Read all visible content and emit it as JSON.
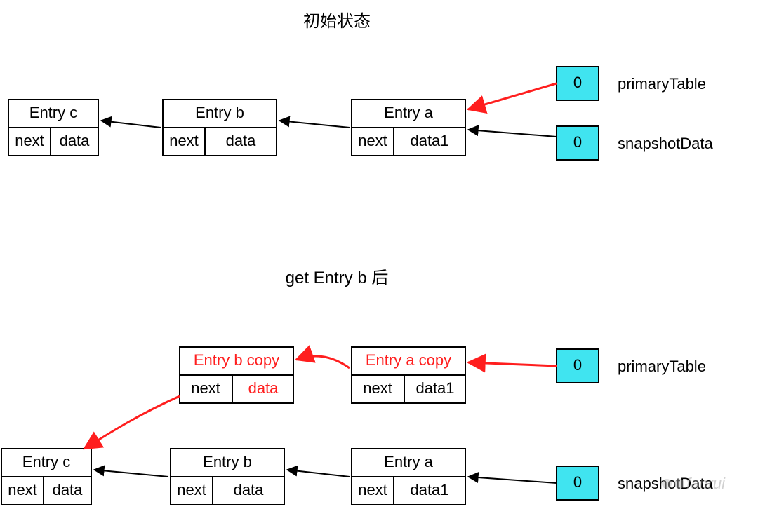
{
  "titles": {
    "top": "初始状态",
    "bottom": "get Entry b 后"
  },
  "labels": {
    "primaryTable": "primaryTable",
    "snapshotData": "snapshotData"
  },
  "cells": {
    "next": "next",
    "data": "data",
    "data1": "data1",
    "zero": "0"
  },
  "entries": {
    "a": "Entry a",
    "b": "Entry b",
    "c": "Entry c",
    "aCopy": "Entry a copy",
    "bCopy": "Entry b copy"
  },
  "watermark": "fanrui"
}
